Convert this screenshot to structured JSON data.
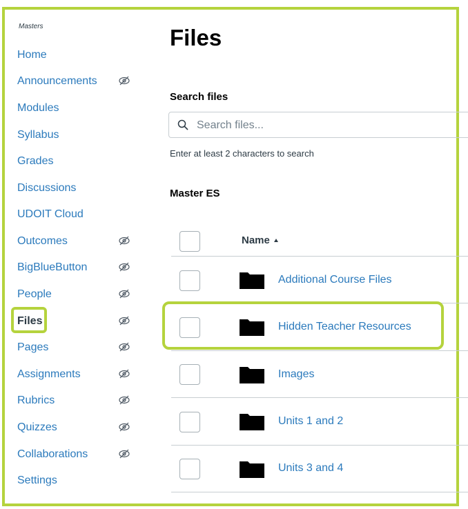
{
  "course": {
    "name": "Masters"
  },
  "nav": [
    {
      "label": "Home",
      "hidden": false
    },
    {
      "label": "Announcements",
      "hidden": true
    },
    {
      "label": "Modules",
      "hidden": false
    },
    {
      "label": "Syllabus",
      "hidden": false
    },
    {
      "label": "Grades",
      "hidden": false
    },
    {
      "label": "Discussions",
      "hidden": false
    },
    {
      "label": "UDOIT Cloud",
      "hidden": false
    },
    {
      "label": "Outcomes",
      "hidden": true
    },
    {
      "label": "BigBlueButton",
      "hidden": true
    },
    {
      "label": "People",
      "hidden": true
    },
    {
      "label": "Files",
      "hidden": true,
      "active": true
    },
    {
      "label": "Pages",
      "hidden": true
    },
    {
      "label": "Assignments",
      "hidden": true
    },
    {
      "label": "Rubrics",
      "hidden": true
    },
    {
      "label": "Quizzes",
      "hidden": true
    },
    {
      "label": "Collaborations",
      "hidden": true
    },
    {
      "label": "Settings",
      "hidden": false
    }
  ],
  "page": {
    "title": "Files"
  },
  "search": {
    "label": "Search files",
    "placeholder": "Search files...",
    "hint": "Enter at least 2 characters to search"
  },
  "folder": {
    "heading": "Master ES"
  },
  "table": {
    "name_header": "Name",
    "rows": [
      {
        "name": "Additional Course Files"
      },
      {
        "name": "Hidden Teacher Resources"
      },
      {
        "name": "Images"
      },
      {
        "name": "Units 1 and 2"
      },
      {
        "name": "Units 3 and 4"
      }
    ]
  },
  "colors": {
    "highlight": "#b5d33d",
    "link": "#2b7abc"
  }
}
